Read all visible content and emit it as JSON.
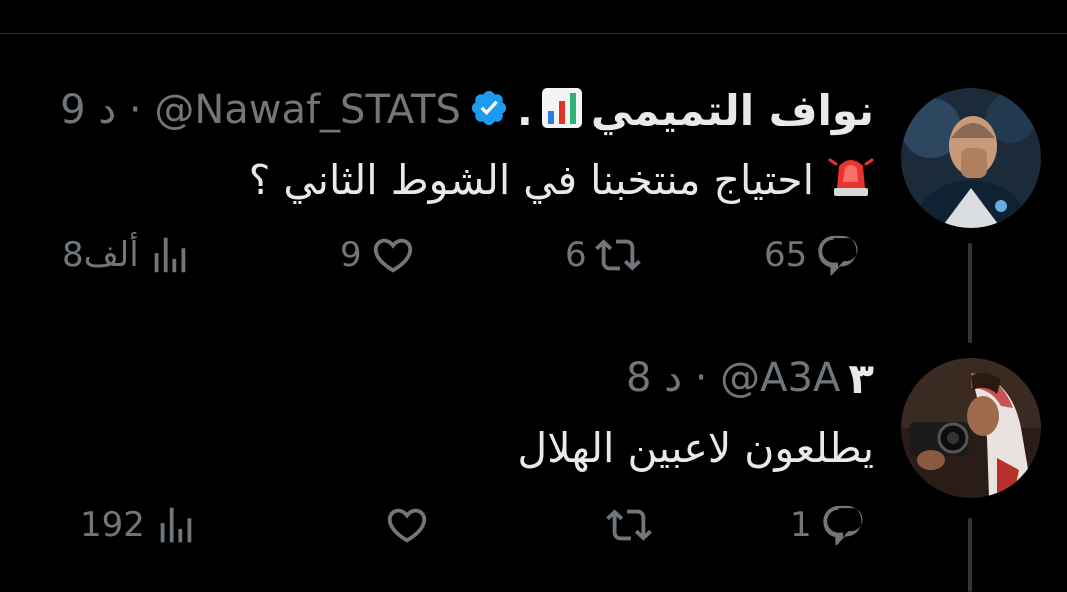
{
  "tweets": [
    {
      "name": "نواف التميمي",
      "name_suffix": ".",
      "verified": true,
      "handle": "@Nawaf_STATS",
      "separator": "·",
      "time": "9 د",
      "text": "احتياج منتخبنا في الشوط الثاني ؟",
      "emoji_name": "rotating-light-icon",
      "name_emoji": "bar-chart-icon",
      "replies": "65",
      "retweets": "6",
      "likes": "9",
      "views": "8ألف"
    },
    {
      "name": "٣",
      "verified": false,
      "handle": "@A3A",
      "separator": "·",
      "time": "8 د",
      "text": "يطلعون لاعبين الهلال",
      "replies": "1",
      "retweets": "",
      "likes": "",
      "views": "192"
    }
  ],
  "colors": {
    "background": "#000000",
    "text": "#e7e9ea",
    "secondary": "#71767b",
    "verified": "#1d9bf0",
    "divider": "#2f3336"
  }
}
